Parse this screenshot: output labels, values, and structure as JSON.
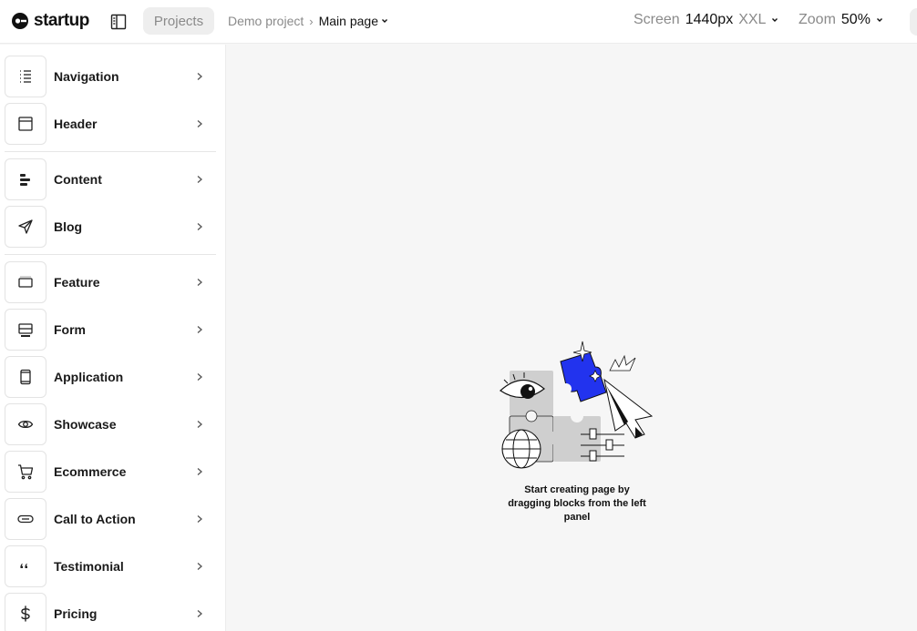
{
  "app": {
    "name": "startup"
  },
  "header": {
    "projects_label": "Projects",
    "breadcrumb": {
      "project": "Demo project",
      "separator": "›",
      "page": "Main page"
    },
    "screen": {
      "label": "Screen",
      "value": "1440px",
      "size": "XXL"
    },
    "zoom": {
      "label": "Zoom",
      "value": "50%"
    }
  },
  "sidebar": {
    "items": [
      {
        "label": "Navigation",
        "icon": "list-icon"
      },
      {
        "label": "Header",
        "icon": "header-layout-icon"
      },
      {
        "label": "Content",
        "icon": "align-left-icon"
      },
      {
        "label": "Blog",
        "icon": "send-icon"
      },
      {
        "label": "Feature",
        "icon": "feature-card-icon"
      },
      {
        "label": "Form",
        "icon": "form-icon"
      },
      {
        "label": "Application",
        "icon": "phone-icon"
      },
      {
        "label": "Showcase",
        "icon": "eye-icon"
      },
      {
        "label": "Ecommerce",
        "icon": "cart-icon"
      },
      {
        "label": "Call to Action",
        "icon": "cta-button-icon"
      },
      {
        "label": "Testimonial",
        "icon": "quote-icon"
      },
      {
        "label": "Pricing",
        "icon": "dollar-icon"
      }
    ]
  },
  "canvas": {
    "empty_message": "Start creating page by dragging blocks from the left panel"
  },
  "colors": {
    "accent": "#2233ee",
    "puzzle_gray": "#cfcfcf",
    "background": "#f6f6f6"
  }
}
